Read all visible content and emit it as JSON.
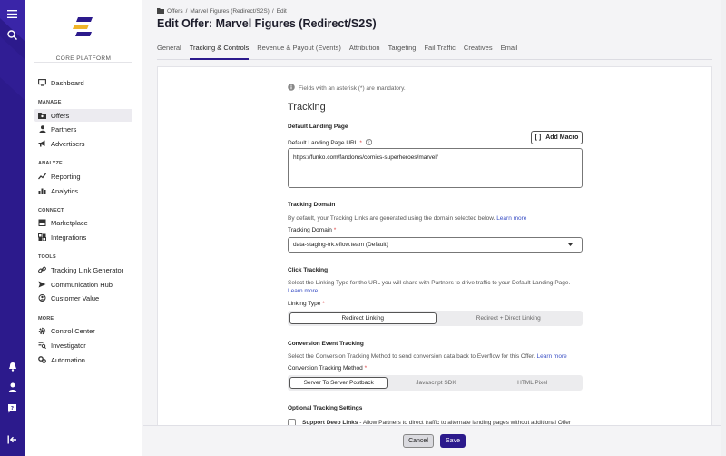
{
  "sidebar": {
    "platform_label": "CORE PLATFORM",
    "sections": {
      "manage": "MANAGE",
      "analyze": "ANALYZE",
      "connect": "CONNECT",
      "tools": "TOOLS",
      "more": "MORE"
    },
    "items": {
      "dashboard": "Dashboard",
      "offers": "Offers",
      "partners": "Partners",
      "advertisers": "Advertisers",
      "reporting": "Reporting",
      "analytics": "Analytics",
      "marketplace": "Marketplace",
      "integrations": "Integrations",
      "tracking_link_generator": "Tracking Link Generator",
      "communication_hub": "Communication Hub",
      "customer_value": "Customer Value",
      "control_center": "Control Center",
      "investigator": "Investigator",
      "automation": "Automation"
    },
    "active": "offers"
  },
  "breadcrumb": {
    "root": "Offers",
    "sep": "/",
    "item": "Marvel Figures (Redirect/S2S)",
    "current": "Edit"
  },
  "page_title": "Edit Offer: Marvel Figures (Redirect/S2S)",
  "tabs": [
    "General",
    "Tracking & Controls",
    "Revenue & Payout (Events)",
    "Attribution",
    "Targeting",
    "Fail Traffic",
    "Creatives",
    "Email"
  ],
  "active_tab": "Tracking & Controls",
  "form": {
    "mandatory_note": "Fields with an asterisk (*) are mandatory.",
    "heading": "Tracking",
    "default_landing": {
      "title": "Default Landing Page",
      "label": "Default Landing Page URL",
      "star": "*",
      "macro_button": "Add Macro",
      "macro_icon_text": "[ ]",
      "url_value": "https://funko.com/fandoms/comics-superheroes/marvel/"
    },
    "tracking_domain": {
      "title": "Tracking Domain",
      "desc": "By default, your Tracking Links are generated using the domain selected below.",
      "link": "Learn more",
      "label": "Tracking Domain",
      "star": "*",
      "selected": "data-staging-trk.eflow.team (Default)"
    },
    "click_tracking": {
      "title": "Click Tracking",
      "desc": "Select the Linking Type for the URL you will share with Partners to drive traffic to your Default Landing Page.",
      "link": "Learn more",
      "label": "Linking Type",
      "star": "*",
      "options": [
        "Redirect Linking",
        "Redirect + Direct Linking"
      ],
      "selected": "Redirect Linking"
    },
    "conversion": {
      "title": "Conversion Event Tracking",
      "desc": "Select the Conversion Tracking Method to send conversion data back to Everflow for this Offer.",
      "link": "Learn more",
      "label": "Conversion Tracking Method",
      "star": "*",
      "options": [
        "Server To Server Postback",
        "Javascript SDK",
        "HTML Pixel"
      ],
      "selected": "Server To Server Postback"
    },
    "optional": {
      "title": "Optional Tracking Settings",
      "deep_links_label": "Support Deep Links",
      "deep_links_desc": " - Allow Partners to direct traffic to alternate landing pages without additional Offer"
    }
  },
  "footer": {
    "cancel": "Cancel",
    "save": "Save"
  },
  "colors": {
    "brand": "#2c1a8c",
    "link": "#3a4fc4"
  }
}
